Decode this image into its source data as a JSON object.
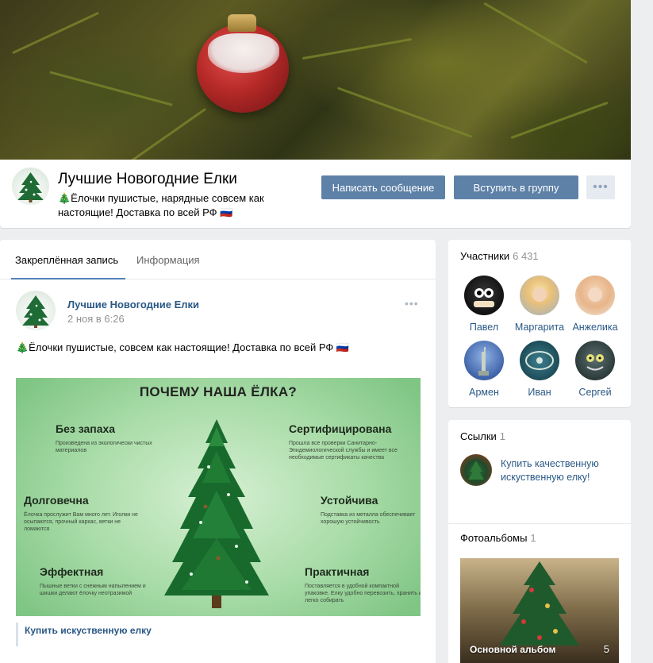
{
  "group": {
    "name": "Лучшие Новогодние Елки",
    "status": "🎄Ёлочки пушистые, нарядные совсем как настоящие! Доставка по всей РФ 🇷🇺"
  },
  "actions": {
    "message_label": "Написать сообщение",
    "join_label": "Вступить в группу",
    "more_label": "•••"
  },
  "tabs": [
    {
      "label": "Закреплённая запись",
      "active": true
    },
    {
      "label": "Информация",
      "active": false
    }
  ],
  "post": {
    "author": "Лучшие Новогодние Елки",
    "date": "2 ноя в 6:26",
    "more_label": "•••",
    "text": "🎄Ёлочки пушистые, совсем как настоящие! Доставка по всей РФ 🇷🇺",
    "image": {
      "title": "ПОЧЕМУ НАША ЁЛКА?",
      "features": [
        {
          "heading": "Без запаха",
          "text": "Произведена из экологически чистых материалов"
        },
        {
          "heading": "Долговечна",
          "text": "Ёлочка прослужит Вам много лет. Иголки не осыпаются, прочный каркас, ветки не ломаются"
        },
        {
          "heading": "Эффектная",
          "text": "Пышные ветки с снежным напылением и шишки делают ёлочку неотразимой"
        },
        {
          "heading": "Сертифицирована",
          "text": "Прошла все проверки Санитарно-Эпидемиологической службы и имеет все необходимые сертификаты качества"
        },
        {
          "heading": "Устойчива",
          "text": "Подставка из металла обеспечивает хорошую устойчивость"
        },
        {
          "heading": "Практичная",
          "text": "Поставляется в удобной компактной упаковке. Елку удобно перевозить, хранить и легко собирать"
        }
      ]
    },
    "link_label": "Купить искуственную елку"
  },
  "members": {
    "title": "Участники",
    "count": "6 431",
    "list": [
      {
        "name": "Павел",
        "color": "#1b1b1b"
      },
      {
        "name": "Маргарита",
        "color": "#e8c07a"
      },
      {
        "name": "Анжелика",
        "color": "#e7b58a"
      },
      {
        "name": "Армен",
        "color": "#3f63a8"
      },
      {
        "name": "Иван",
        "color": "#1d4c58"
      },
      {
        "name": "Сергей",
        "color": "#2c3a3a"
      }
    ]
  },
  "links": {
    "title": "Ссылки",
    "count": "1",
    "item_label": "Купить качественную искуственную елку!"
  },
  "albums": {
    "title": "Фотоальбомы",
    "count": "1",
    "album_name": "Основной альбом",
    "album_count": "5"
  }
}
